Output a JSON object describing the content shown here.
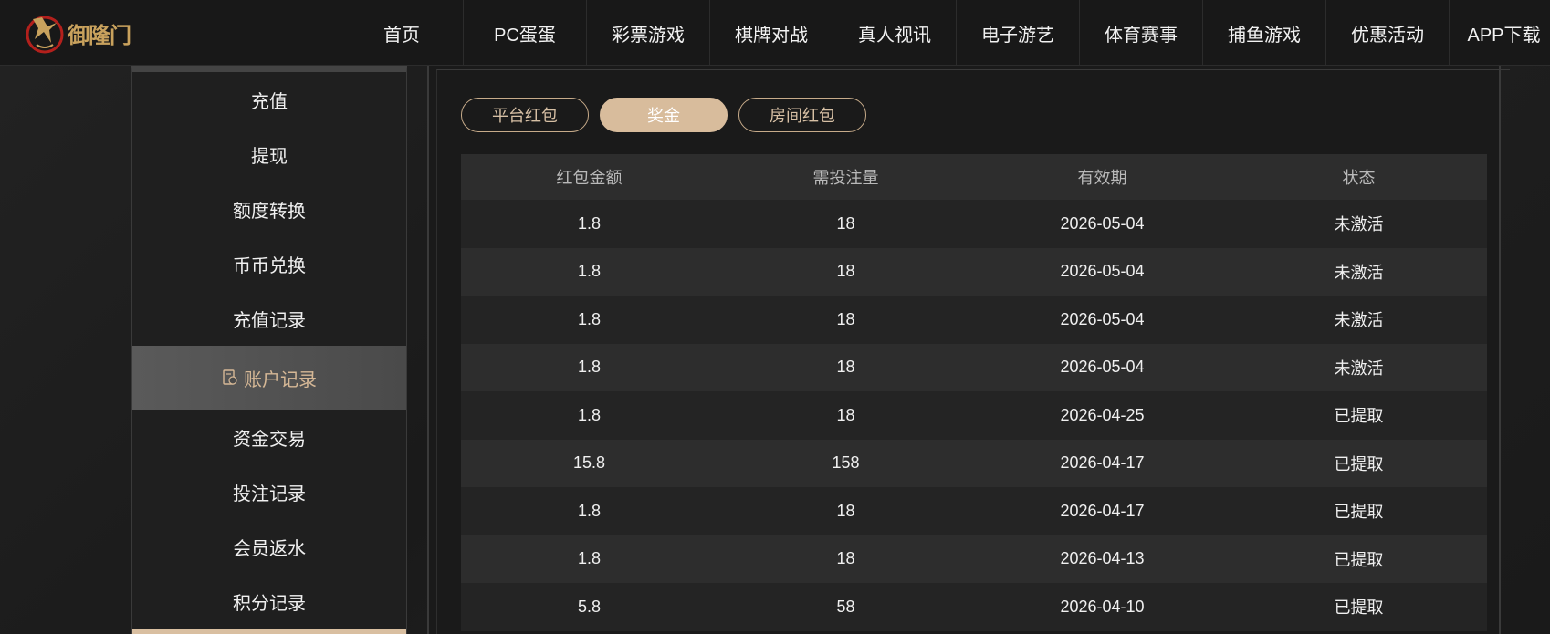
{
  "logo": {
    "brand": "御隆门"
  },
  "nav": [
    "首页",
    "PC蛋蛋",
    "彩票游戏",
    "棋牌对战",
    "真人视讯",
    "电子游艺",
    "体育赛事",
    "捕鱼游戏",
    "优惠活动",
    "APP下载"
  ],
  "sidebar": {
    "items": [
      "充值",
      "提现",
      "额度转换",
      "币币兑换",
      "充值记录",
      "账户记录",
      "资金交易",
      "投注记录",
      "会员返水",
      "积分记录"
    ],
    "active_index": 5
  },
  "tabs": [
    "平台红包",
    "奖金",
    "房间红包"
  ],
  "active_tab": 1,
  "table": {
    "headers": [
      "红包金额",
      "需投注量",
      "有效期",
      "状态"
    ],
    "rows": [
      [
        "1.8",
        "18",
        "2026-05-04",
        "未激活"
      ],
      [
        "1.8",
        "18",
        "2026-05-04",
        "未激活"
      ],
      [
        "1.8",
        "18",
        "2026-05-04",
        "未激活"
      ],
      [
        "1.8",
        "18",
        "2026-05-04",
        "未激活"
      ],
      [
        "1.8",
        "18",
        "2026-04-25",
        "已提取"
      ],
      [
        "15.8",
        "158",
        "2026-04-17",
        "已提取"
      ],
      [
        "1.8",
        "18",
        "2026-04-17",
        "已提取"
      ],
      [
        "1.8",
        "18",
        "2026-04-13",
        "已提取"
      ],
      [
        "5.8",
        "58",
        "2026-04-10",
        "已提取"
      ]
    ]
  },
  "colors": {
    "accent": "#d8bc9c",
    "background": "#1c1c1c",
    "logo_gold": "#c9a25d",
    "logo_red": "#b3201c"
  }
}
